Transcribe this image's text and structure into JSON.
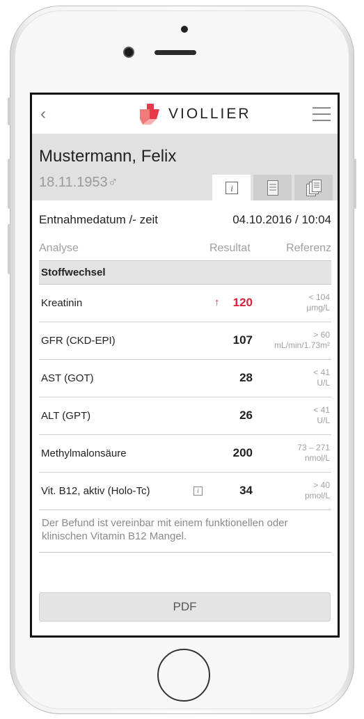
{
  "app": {
    "brand": "VIOLLIER",
    "brand_color": "#d4243b"
  },
  "patient": {
    "name": "Mustermann, Felix",
    "dob": "18.11.1953",
    "gender_symbol": "♂"
  },
  "tabs": [
    {
      "icon": "info-icon",
      "active": true
    },
    {
      "icon": "document-icon",
      "active": false
    },
    {
      "icon": "documents-icon",
      "active": false
    }
  ],
  "sample": {
    "label": "Entnahmedatum /- zeit",
    "value": "04.10.2016 / 10:04"
  },
  "columns": {
    "analysis": "Analyse",
    "result": "Resultat",
    "reference": "Referenz"
  },
  "section": {
    "title": "Stoffwechsel"
  },
  "results": [
    {
      "name": "Kreatinin",
      "value": "120",
      "high": true,
      "ref_range": "< 104",
      "ref_unit": "µmg/L"
    },
    {
      "name": "GFR (CKD-EPI)",
      "value": "107",
      "high": false,
      "ref_range": "> 60",
      "ref_unit": "mL/min/1.73m²"
    },
    {
      "name": "AST (GOT)",
      "value": "28",
      "high": false,
      "ref_range": "< 41",
      "ref_unit": "U/L"
    },
    {
      "name": "ALT (GPT)",
      "value": "26",
      "high": false,
      "ref_range": "< 41",
      "ref_unit": "U/L"
    },
    {
      "name": "Methylmalonsäure",
      "value": "200",
      "high": false,
      "ref_range": "73 – 271",
      "ref_unit": "nmol/L"
    },
    {
      "name": "Vit. B12, aktiv (Holo-Tc)",
      "value": "34",
      "high": false,
      "ref_range": "> 40",
      "ref_unit": "pmol/L",
      "info": "i"
    }
  ],
  "high_marker": "↑",
  "note": "Der Befund ist vereinbar mit einem funktionellen oder klinischen Vitamin B12 Mangel.",
  "pdf_button": "PDF"
}
